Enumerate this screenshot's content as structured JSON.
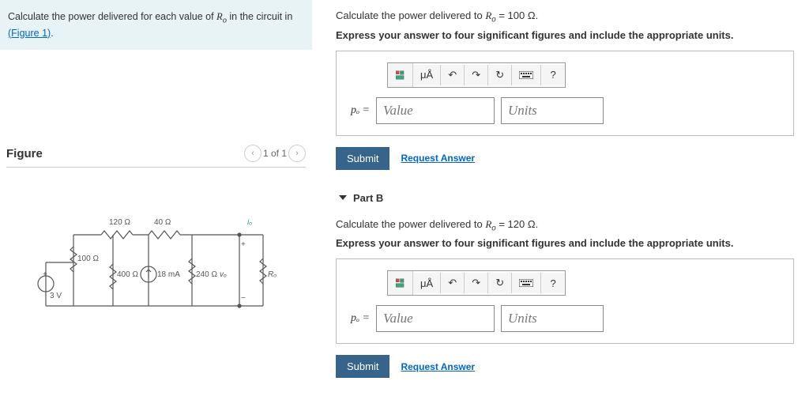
{
  "intro": {
    "text_before": "Calculate the power delivered for each value of ",
    "var": "R",
    "sub": "o",
    "text_after": " in the circuit in ",
    "link": "(Figure 1)",
    "period": "."
  },
  "figure": {
    "title": "Figure",
    "pager": "1 of 1",
    "labels": {
      "r120": "120 Ω",
      "r40": "40 Ω",
      "r100": "100 Ω",
      "r400": "400 Ω",
      "r240": "240 Ω",
      "i18": "18 mA",
      "v3": "3 V",
      "io": "iₒ",
      "vo": "vₒ",
      "ro": "Rₒ",
      "plus": "+",
      "minus": "−"
    }
  },
  "partA": {
    "q_before": "Calculate the power delivered to ",
    "var": "R",
    "sub": "o",
    "q_after": " = 100 Ω.",
    "instruction": "Express your answer to four significant figures and include the appropriate units.",
    "po": "pₒ =",
    "value_ph": "Value",
    "units_ph": "Units",
    "submit": "Submit",
    "request": "Request Answer"
  },
  "partB": {
    "head": "Part B",
    "q_before": "Calculate the power delivered to ",
    "var": "R",
    "sub": "o",
    "q_after": " = 120 Ω.",
    "instruction": "Express your answer to four significant figures and include the appropriate units.",
    "po": "pₒ =",
    "value_ph": "Value",
    "units_ph": "Units",
    "submit": "Submit",
    "request": "Request Answer"
  },
  "toolbar": {
    "mu": "μÅ",
    "undo": "↶",
    "redo": "↷",
    "reset": "↻",
    "help": "?"
  }
}
